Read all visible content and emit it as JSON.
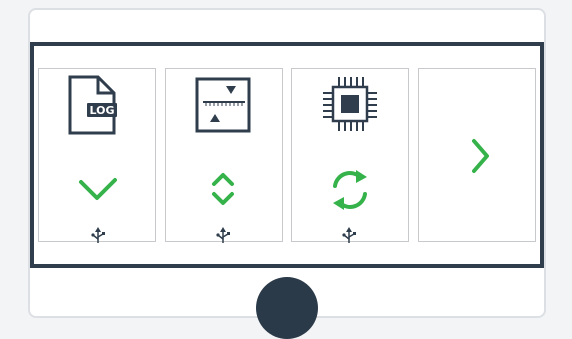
{
  "panels": [
    {
      "id": "log",
      "icon": "log-file-icon",
      "icon_text": "LOG",
      "status_icon": "checkmark-icon",
      "usb": "usb-icon"
    },
    {
      "id": "range",
      "icon": "range-adjust-icon",
      "status_icon": "chevron-up-down-icon",
      "usb": "usb-icon"
    },
    {
      "id": "chip",
      "icon": "microchip-icon",
      "status_icon": "refresh-icon",
      "usb": "usb-icon"
    },
    {
      "id": "next",
      "status_icon": "chevron-right-icon"
    }
  ],
  "colors": {
    "accent_green": "#35b34a",
    "dark": "#2f3d4c",
    "border": "#c7c9cc"
  }
}
